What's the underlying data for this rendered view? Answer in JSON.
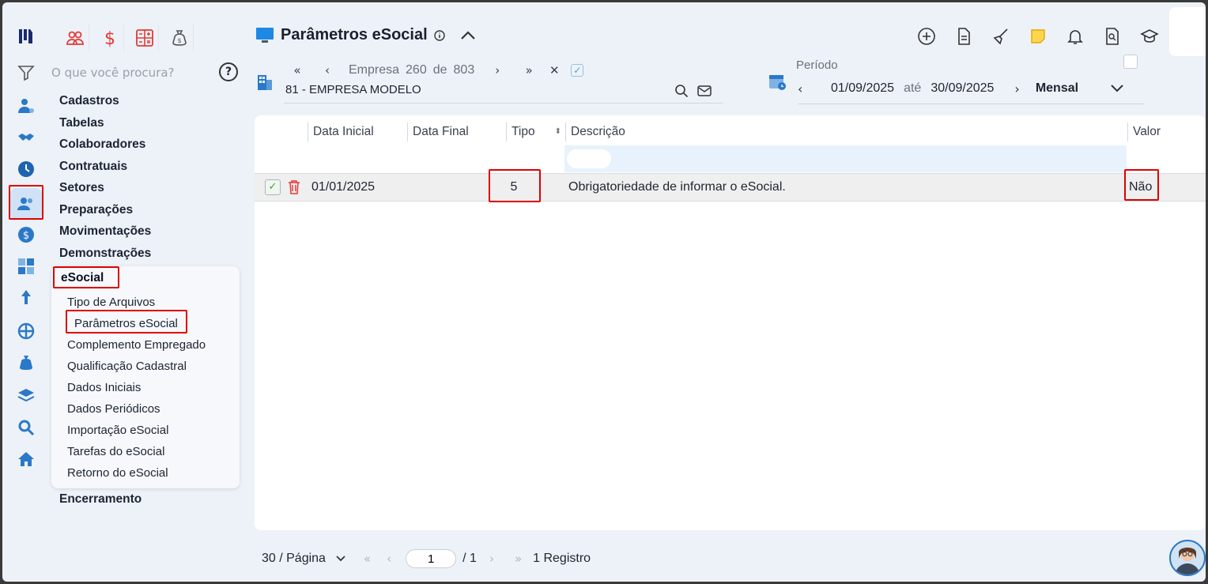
{
  "app": {
    "logo": "mi-logo"
  },
  "apps": [
    {
      "icon": "people-icon"
    },
    {
      "icon": "dollar-icon"
    },
    {
      "icon": "calculator-icon"
    },
    {
      "icon": "money-bag-icon"
    }
  ],
  "search": {
    "placeholder": "O que você procura?"
  },
  "menu": {
    "items": [
      "Cadastros",
      "Tabelas",
      "Colaboradores",
      "Contratuais",
      "Setores",
      "Preparações",
      "Movimentações",
      "Demonstrações"
    ],
    "group": {
      "label": "eSocial",
      "items": [
        "Tipo de Arquivos",
        "Parâmetros eSocial",
        "Complemento Empregado",
        "Qualificação Cadastral",
        "Dados Iniciais",
        "Dados Periódicos",
        "Importação eSocial",
        "Tarefas do eSocial",
        "Retorno do eSocial"
      ]
    },
    "last": "Encerramento"
  },
  "header": {
    "title": "Parâmetros eSocial"
  },
  "empresa": {
    "label": "Empresa",
    "current": "260",
    "of": "de",
    "total": "803",
    "name": "81 - EMPRESA MODELO"
  },
  "periodo": {
    "label": "Período",
    "start": "01/09/2025",
    "sep": "até",
    "end": "30/09/2025",
    "mode": "Mensal"
  },
  "table": {
    "columns": [
      "Data Inicial",
      "Data Final",
      "Tipo",
      "Descrição",
      "Valor"
    ],
    "rows": [
      {
        "data_inicial": "01/01/2025",
        "data_final": "",
        "tipo": "5",
        "descricao": "Obrigatoriedade de informar o eSocial.",
        "valor": "Não"
      }
    ]
  },
  "pagination": {
    "per_page": "30 / Página",
    "page": "1",
    "total_pages": "/ 1",
    "records": "1 Registro"
  },
  "colors": {
    "accent": "#2b78c8",
    "highlight": "#e00000",
    "danger": "#e53935"
  }
}
